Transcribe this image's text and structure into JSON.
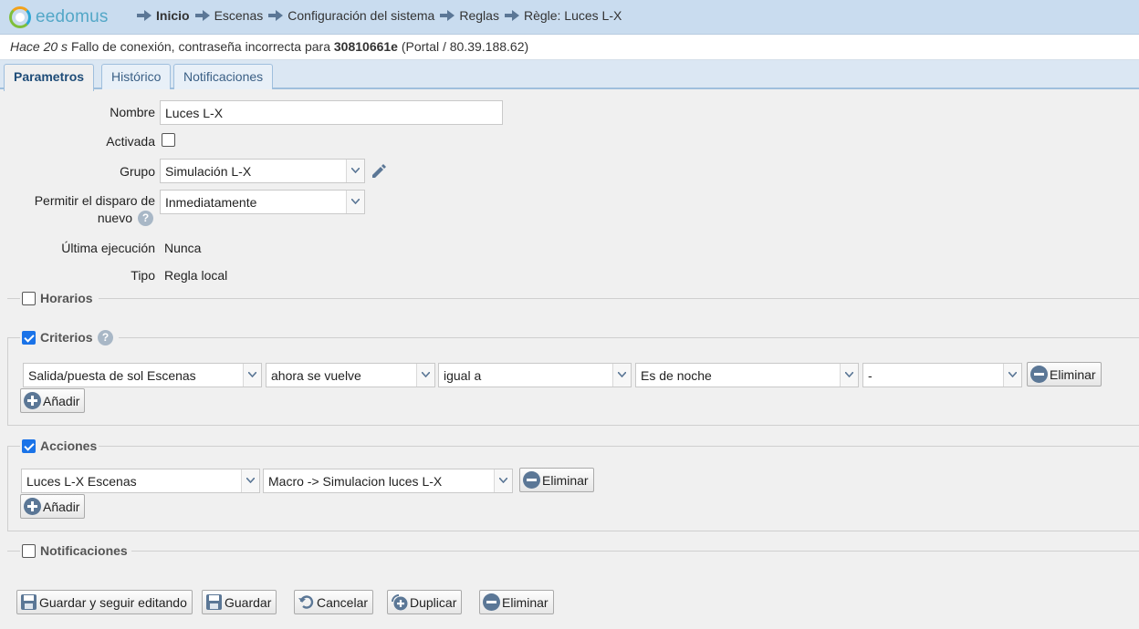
{
  "app": {
    "logo_text": "eedomus"
  },
  "breadcrumb": [
    "Inicio",
    "Escenas",
    "Configuración del sistema",
    "Reglas",
    "Règle: Luces L-X"
  ],
  "alert": {
    "ago": "Hace 20 s",
    "message": "Fallo de conexión, contraseña incorrecta para",
    "account": "30810661e",
    "detail": "(Portal / 80.39.188.62)"
  },
  "tabs": [
    "Parametros",
    "Histórico",
    "Notificaciones"
  ],
  "form": {
    "nombre_label": "Nombre",
    "nombre_value": "Luces L-X",
    "activada_label": "Activada",
    "grupo_label": "Grupo",
    "grupo_value": "Simulación L-X",
    "disparo_label_1": "Permitir el disparo de",
    "disparo_label_2": "nuevo",
    "disparo_value": "Inmediatamente",
    "ultima_label": "Última ejecución",
    "ultima_value": "Nunca",
    "tipo_label": "Tipo",
    "tipo_value": "Regla local"
  },
  "sections": {
    "horarios": "Horarios",
    "criterios": "Criterios",
    "acciones": "Acciones",
    "notificaciones": "Notificaciones"
  },
  "criterios_row": [
    "Salida/puesta de sol Escenas",
    "ahora se vuelve",
    "igual a",
    "Es de noche",
    "-"
  ],
  "acciones_row": [
    "Luces L-X Escenas",
    "Macro -> Simulacion luces L-X"
  ],
  "labels": {
    "eliminar": "Eliminar",
    "anadir": "Añadir",
    "help": "?"
  },
  "footer_buttons": [
    "Guardar y seguir editando",
    "Guardar",
    "Cancelar",
    "Duplicar",
    "Eliminar"
  ],
  "colors": {
    "header_bg": "#c9dcef",
    "checkbox_on": "#1a73e8",
    "icon_blue": "#5b7796"
  }
}
